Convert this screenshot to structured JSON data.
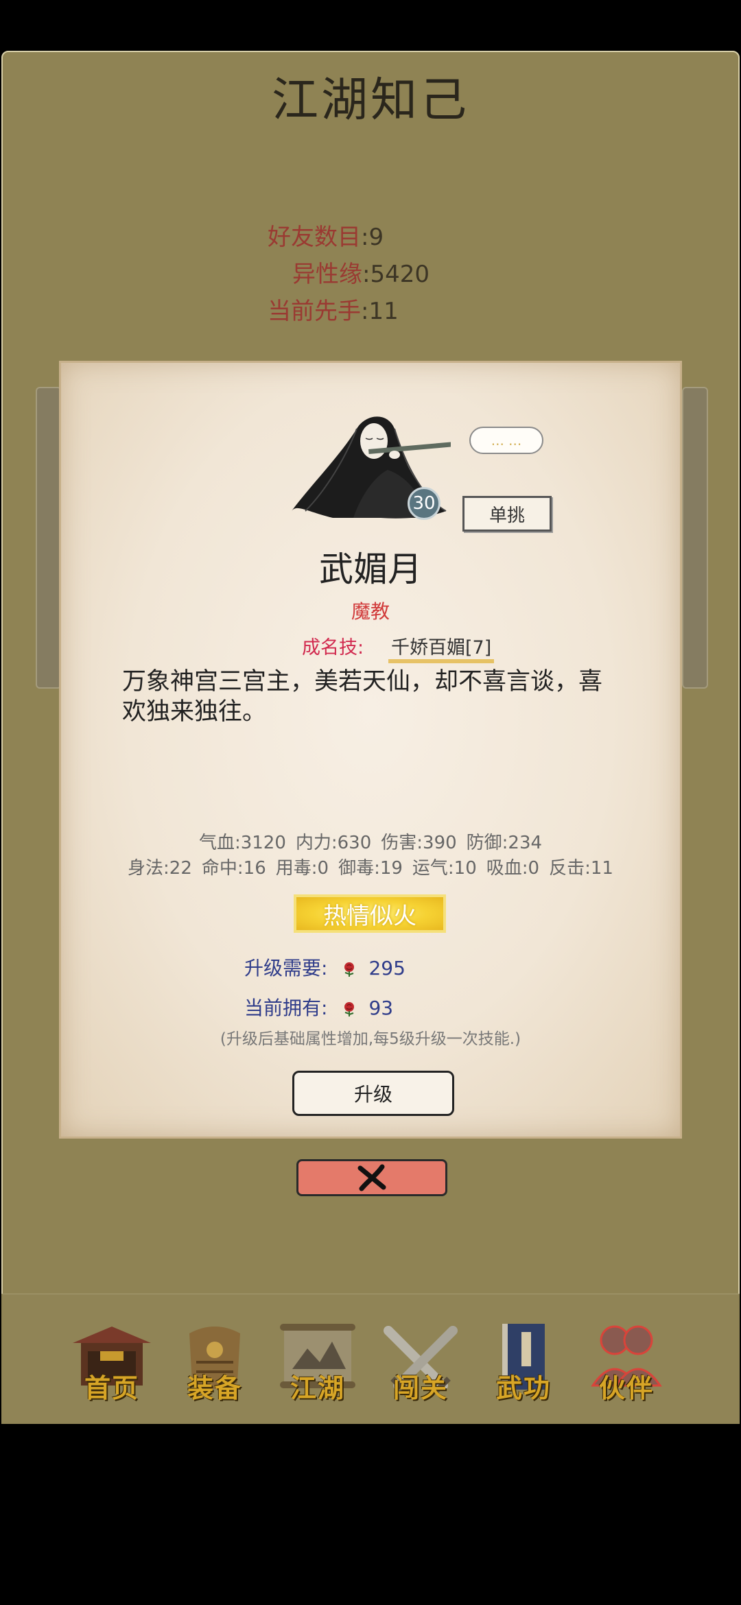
{
  "header": {
    "title": "江湖知己"
  },
  "stats": {
    "friends_label": "好友数目",
    "friends_value": "9",
    "affinity_label": "异性缘",
    "affinity_value": "5420",
    "first_hand_label": "当前先手",
    "first_hand_value": "11"
  },
  "character": {
    "level": "30",
    "speech": "... ...",
    "duel_label": "单挑",
    "name": "武媚月",
    "sect": "魔教",
    "skill_label": "成名技:",
    "skill_name": "千娇百媚[7]",
    "description": "万象神宫三宫主，美若天仙，却不喜言谈，喜欢独来独往。",
    "stats_row1": [
      "气血:3120",
      "内力:630",
      "伤害:390",
      "防御:234"
    ],
    "stats_row2": [
      "身法:22",
      "命中:16",
      "用毒:0",
      "御毒:19",
      "运气:10",
      "吸血:0",
      "反击:11"
    ],
    "relationship_status": "热情似火"
  },
  "upgrade": {
    "need_label": "升级需要:",
    "need_value": "295",
    "have_label": "当前拥有:",
    "have_value": "93",
    "note": "(升级后基础属性增加,每5级升级一次技能.)",
    "button_label": "升级"
  },
  "nav": {
    "items": [
      {
        "label": "首页",
        "icon": "temple-icon"
      },
      {
        "label": "装备",
        "icon": "armor-icon"
      },
      {
        "label": "江湖",
        "icon": "scroll-map-icon"
      },
      {
        "label": "闯关",
        "icon": "crossed-swords-icon"
      },
      {
        "label": "武功",
        "icon": "book-icon"
      },
      {
        "label": "伙伴",
        "icon": "companions-icon"
      }
    ]
  },
  "colors": {
    "frame_bg": "#8f8354",
    "stat_label": "#9a3a32",
    "sect": "#d13b3b",
    "skill_label": "#d1294e",
    "upgrade_text": "#2f3c8a",
    "close_button": "#e47a6a",
    "nav_label": "#d7a526"
  }
}
